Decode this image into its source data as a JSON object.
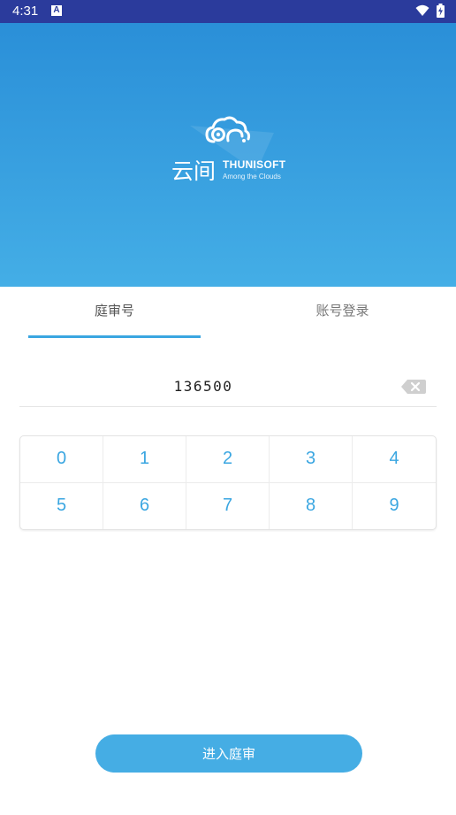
{
  "status_bar": {
    "time": "4:31",
    "notification_badge": "A"
  },
  "logo": {
    "word": "云间",
    "brand": "THUNISOFT",
    "tagline": "Among the Clouds"
  },
  "tabs": [
    {
      "label": "庭审号",
      "active": true
    },
    {
      "label": "账号登录",
      "active": false
    }
  ],
  "code_input": {
    "value": "136500"
  },
  "keypad": {
    "keys": [
      "0",
      "1",
      "2",
      "3",
      "4",
      "5",
      "6",
      "7",
      "8",
      "9"
    ]
  },
  "enter_button": {
    "label": "进入庭审"
  },
  "colors": {
    "accent": "#3aa6e1",
    "status_bar": "#2b3b9c",
    "hero_top": "#2a8fd8",
    "hero_bottom": "#44aee6"
  }
}
